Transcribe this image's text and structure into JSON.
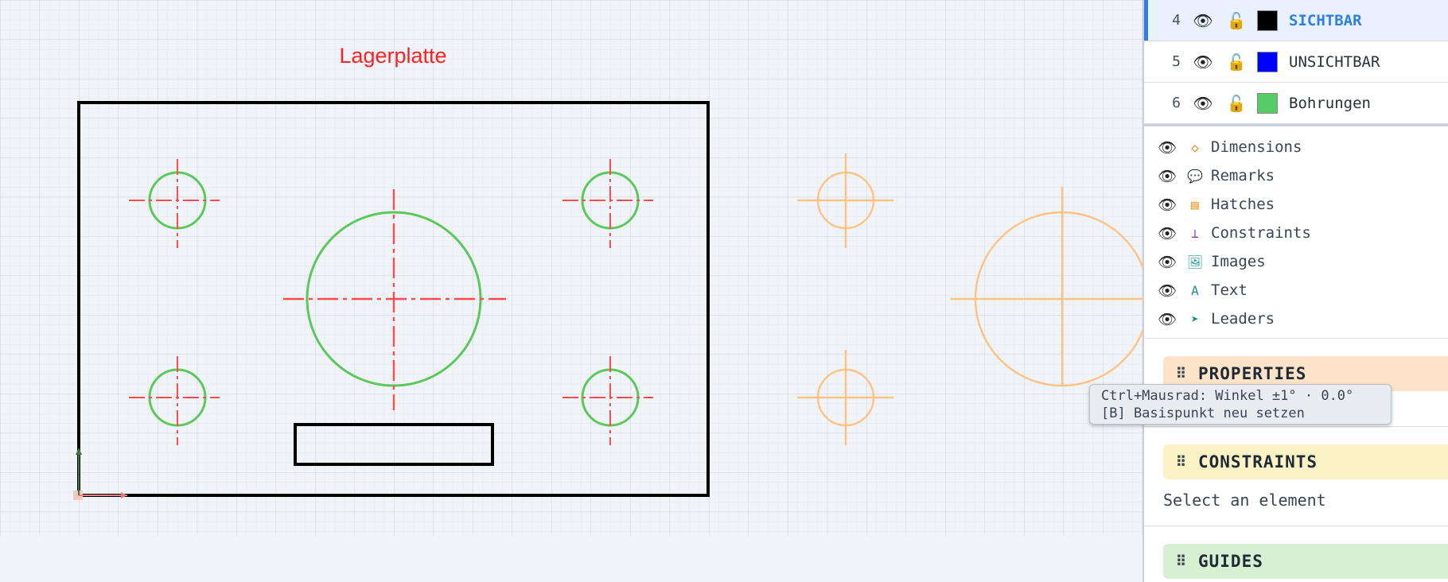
{
  "canvas": {
    "title": "Lagerplatte",
    "colors": {
      "outline": "#000000",
      "holes": "#5cc85c",
      "centerlines": "#ff4444",
      "ghost": "#ffbf7a",
      "grid": "#cfd7e0"
    }
  },
  "layers": [
    {
      "num": "4",
      "name": "SICHTBAR",
      "color": "#000000",
      "active": true,
      "visible_icon": "eye-icon",
      "lock_icon": "unlocked-icon"
    },
    {
      "num": "5",
      "name": "UNSICHTBAR",
      "color": "#0000ff",
      "active": false,
      "visible_icon": "eye-icon",
      "lock_icon": "unlocked-icon"
    },
    {
      "num": "6",
      "name": "Bohrungen",
      "color": "#55cc66",
      "active": false,
      "visible_icon": "eye-icon",
      "lock_icon": "unlocked-icon"
    }
  ],
  "categories": [
    {
      "label": "Dimensions",
      "icon": "diamond-icon",
      "glyph": "◇",
      "color": "#f07a20"
    },
    {
      "label": "Remarks",
      "icon": "speech-bubble-icon",
      "glyph": "💬",
      "color": "#3a4452"
    },
    {
      "label": "Hatches",
      "icon": "hatch-icon",
      "glyph": "▤",
      "color": "#f0901a"
    },
    {
      "label": "Constraints",
      "icon": "perpendicular-icon",
      "glyph": "⊥",
      "color": "#8a3fc2"
    },
    {
      "label": "Images",
      "icon": "image-icon",
      "glyph": "🖼",
      "color": "#1d9aa6"
    },
    {
      "label": "Text",
      "icon": "text-icon",
      "glyph": "A",
      "color": "#1d8a8a"
    },
    {
      "label": "Leaders",
      "icon": "arrow-icon",
      "glyph": "➤",
      "color": "#1d8a8a"
    }
  ],
  "panels": {
    "properties": {
      "title": "PROPERTIES",
      "color": "#fde3c8"
    },
    "constraints": {
      "title": "CONSTRAINTS",
      "color": "#fbf3c6",
      "empty_text": "Select an element"
    },
    "guides": {
      "title": "GUIDES",
      "color": "#d8f0d2"
    }
  },
  "tooltip": {
    "line1": "Ctrl+Mausrad: Winkel ±1° · 0.0°",
    "line2": "[B] Basispunkt neu setzen"
  }
}
